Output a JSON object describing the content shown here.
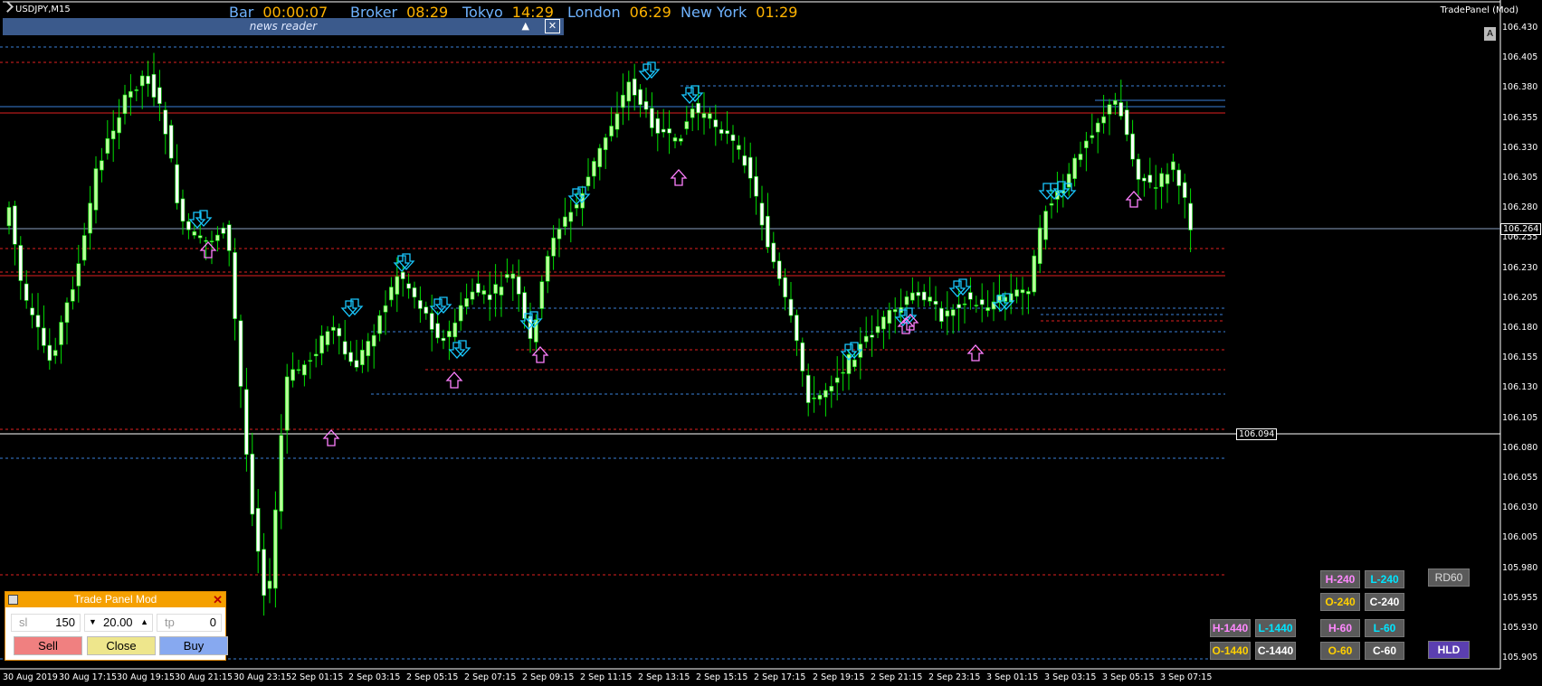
{
  "symbol": "USDJPY,M15",
  "header": {
    "items": [
      {
        "key": "Bar",
        "value": "00:00:07"
      },
      {
        "key": "Broker",
        "value": "08:29"
      },
      {
        "key": "Tokyo",
        "value": "14:29"
      },
      {
        "key": "London",
        "value": "06:29"
      },
      {
        "key": "New York",
        "value": "01:29"
      }
    ]
  },
  "news_reader": {
    "title": "news reader"
  },
  "indicator_label": "TradePanel (Mod)",
  "corner_button": "A",
  "price_axis": [
    "106.430",
    "106.405",
    "106.380",
    "106.355",
    "106.330",
    "106.305",
    "106.280",
    "106.255",
    "106.230",
    "106.205",
    "106.180",
    "106.155",
    "106.130",
    "106.105",
    "106.080",
    "106.055",
    "106.030",
    "106.005",
    "105.980",
    "105.955",
    "105.930",
    "105.905"
  ],
  "current_price": "106.264",
  "level_label": "106.094",
  "time_axis": [
    "30 Aug 2019",
    "30 Aug 17:15",
    "30 Aug 19:15",
    "30 Aug 21:15",
    "30 Aug 23:15",
    "2 Sep 01:15",
    "2 Sep 03:15",
    "2 Sep 05:15",
    "2 Sep 07:15",
    "2 Sep 09:15",
    "2 Sep 11:15",
    "2 Sep 13:15",
    "2 Sep 15:15",
    "2 Sep 17:15",
    "2 Sep 19:15",
    "2 Sep 21:15",
    "2 Sep 23:15",
    "3 Sep 01:15",
    "3 Sep 03:15",
    "3 Sep 05:15",
    "3 Sep 07:15"
  ],
  "trade_panel": {
    "title": "Trade Panel Mod",
    "sl_label": "sl",
    "sl_value": "150",
    "lot_value": "20.00",
    "tp_label": "tp",
    "tp_value": "0",
    "sell": "Sell",
    "close": "Close",
    "buy": "Buy"
  },
  "level_buttons": {
    "h240": "H-240",
    "l240": "L-240",
    "rd60": "RD60",
    "o240": "O-240",
    "c240": "C-240",
    "h1440": "H-1440",
    "l1440": "L-1440",
    "h60": "H-60",
    "l60": "L-60",
    "o1440": "O-1440",
    "c1440": "C-1440",
    "o60": "O-60",
    "c60": "C-60",
    "hld": "HLD"
  },
  "colors": {
    "bull": "#b9ff9a",
    "bear": "#ffffff",
    "wick": "#00e000",
    "resistance": "#e02020",
    "support": "#3a7fd8",
    "price_line": "#8aa0c0"
  }
}
